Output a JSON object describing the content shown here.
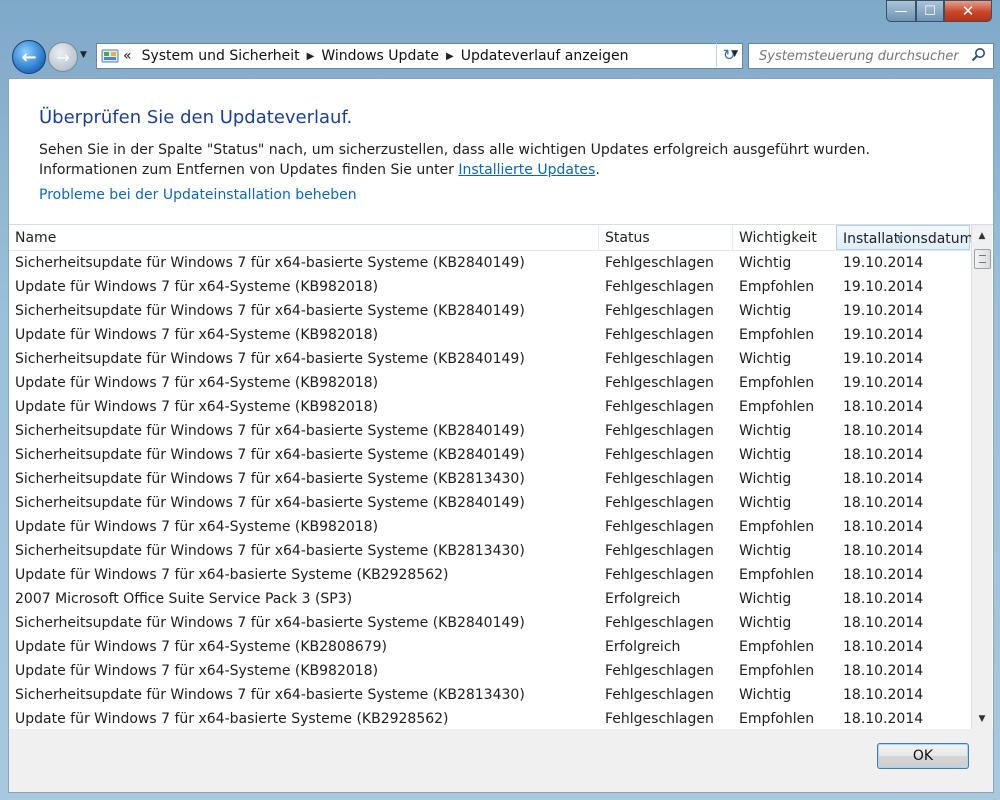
{
  "window": {
    "controls": {
      "minimize": "—",
      "maximize": "☐",
      "close": "✕"
    }
  },
  "navigation": {
    "back_glyph": "←",
    "forward_glyph": "→",
    "breadcrumb_prefix": "«",
    "breadcrumbs": [
      "System und Sicherheit",
      "Windows Update",
      "Updateverlauf anzeigen"
    ],
    "refresh_glyph": "↻",
    "search_placeholder": "Systemsteuerung durchsuchen"
  },
  "page": {
    "heading": "Überprüfen Sie den Updateverlauf.",
    "description_text": "Sehen Sie in der Spalte \"Status\" nach, um sicherzustellen, dass alle wichtigen Updates erfolgreich ausgeführt wurden. Informationen zum Entfernen von Updates finden Sie unter ",
    "description_link": "Installierte Updates",
    "description_end": ".",
    "troubleshoot_link": "Probleme bei der Updateinstallation beheben"
  },
  "table": {
    "columns": [
      "Name",
      "Status",
      "Wichtigkeit",
      "Installationsdatum"
    ],
    "rows": [
      [
        "Sicherheitsupdate für Windows 7 für x64-basierte Systeme (KB2840149)",
        "Fehlgeschlagen",
        "Wichtig",
        "19.10.2014"
      ],
      [
        "Update für Windows 7 für x64-Systeme (KB982018)",
        "Fehlgeschlagen",
        "Empfohlen",
        "19.10.2014"
      ],
      [
        "Sicherheitsupdate für Windows 7 für x64-basierte Systeme (KB2840149)",
        "Fehlgeschlagen",
        "Wichtig",
        "19.10.2014"
      ],
      [
        "Update für Windows 7 für x64-Systeme (KB982018)",
        "Fehlgeschlagen",
        "Empfohlen",
        "19.10.2014"
      ],
      [
        "Sicherheitsupdate für Windows 7 für x64-basierte Systeme (KB2840149)",
        "Fehlgeschlagen",
        "Wichtig",
        "19.10.2014"
      ],
      [
        "Update für Windows 7 für x64-Systeme (KB982018)",
        "Fehlgeschlagen",
        "Empfohlen",
        "19.10.2014"
      ],
      [
        "Update für Windows 7 für x64-Systeme (KB982018)",
        "Fehlgeschlagen",
        "Empfohlen",
        "18.10.2014"
      ],
      [
        "Sicherheitsupdate für Windows 7 für x64-basierte Systeme (KB2840149)",
        "Fehlgeschlagen",
        "Wichtig",
        "18.10.2014"
      ],
      [
        "Sicherheitsupdate für Windows 7 für x64-basierte Systeme (KB2840149)",
        "Fehlgeschlagen",
        "Wichtig",
        "18.10.2014"
      ],
      [
        "Sicherheitsupdate für Windows 7 für x64-basierte Systeme (KB2813430)",
        "Fehlgeschlagen",
        "Wichtig",
        "18.10.2014"
      ],
      [
        "Sicherheitsupdate für Windows 7 für x64-basierte Systeme (KB2840149)",
        "Fehlgeschlagen",
        "Wichtig",
        "18.10.2014"
      ],
      [
        "Update für Windows 7 für x64-Systeme (KB982018)",
        "Fehlgeschlagen",
        "Empfohlen",
        "18.10.2014"
      ],
      [
        "Sicherheitsupdate für Windows 7 für x64-basierte Systeme (KB2813430)",
        "Fehlgeschlagen",
        "Wichtig",
        "18.10.2014"
      ],
      [
        "Update für Windows 7 für x64-basierte Systeme (KB2928562)",
        "Fehlgeschlagen",
        "Empfohlen",
        "18.10.2014"
      ],
      [
        "2007 Microsoft Office Suite Service Pack 3 (SP3)",
        "Erfolgreich",
        "Wichtig",
        "18.10.2014"
      ],
      [
        "Sicherheitsupdate für Windows 7 für x64-basierte Systeme (KB2840149)",
        "Fehlgeschlagen",
        "Wichtig",
        "18.10.2014"
      ],
      [
        "Update für Windows 7 für x64-Systeme (KB2808679)",
        "Erfolgreich",
        "Empfohlen",
        "18.10.2014"
      ],
      [
        "Update für Windows 7 für x64-Systeme (KB982018)",
        "Fehlgeschlagen",
        "Empfohlen",
        "18.10.2014"
      ],
      [
        "Sicherheitsupdate für Windows 7 für x64-basierte Systeme (KB2813430)",
        "Fehlgeschlagen",
        "Wichtig",
        "18.10.2014"
      ],
      [
        "Update für Windows 7 für x64-basierte Systeme (KB2928562)",
        "Fehlgeschlagen",
        "Empfohlen",
        "18.10.2014"
      ]
    ]
  },
  "footer": {
    "ok_label": "OK"
  },
  "colors": {
    "heading": "#1d3f8f",
    "link": "#0d66b3",
    "close_button": "#c8462a",
    "sorted_header": "#dfeefa"
  }
}
